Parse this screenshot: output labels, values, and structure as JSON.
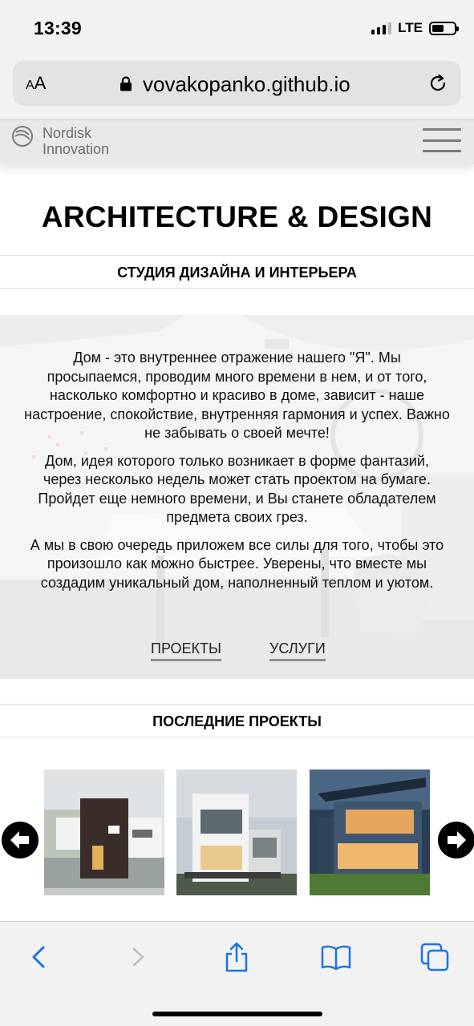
{
  "status_bar": {
    "time": "13:39",
    "network": "LTE",
    "signal_bars_active": 3,
    "signal_bars_total": 4,
    "battery_level_percent": 55
  },
  "browser": {
    "text_size_label_small": "A",
    "text_size_label_large": "A",
    "url": "vovakopanko.github.io",
    "lock_icon": "lock-icon",
    "reload_icon": "reload-icon"
  },
  "site_header": {
    "logo_line1": "Nordisk",
    "logo_line2": "Innovation",
    "menu_icon": "hamburger-menu-icon"
  },
  "page": {
    "title": "ARCHITECTURE & DESIGN",
    "subtitle": "СТУДИЯ ДИЗАЙНА И ИНТЕРЬЕРА",
    "hero_paragraphs": [
      "Дом - это внутреннее отражение нашего \"Я\". Мы просыпаемся, проводим много времени в нем, и от того, насколько комфортно и красиво в доме, зависит - наше настроение, спокойствие, внутренняя гармония и успех. Важно не забывать о своей мечте!",
      "Дом, идея которого только возникает в форме фантазий, через несколько недель может стать проектом на бумаге. Пройдет еще немного времени, и Вы станете обладателем предмета своих грез.",
      "А мы в свою очередь приложем все силы для того, чтобы это произошло как можно быстрее. Уверены, что вместе мы создадим уникальный дом, наполненный теплом и уютом."
    ],
    "hero_links": {
      "projects": "ПРОЕКТЫ",
      "services": "УСЛУГИ"
    },
    "recent_projects_heading": "ПОСЛЕДНИЕ ПРОЕКТЫ",
    "carousel": {
      "prev_icon": "arrow-left-icon",
      "next_icon": "arrow-right-icon",
      "items": [
        "project-photo-1",
        "project-photo-2",
        "project-photo-3"
      ]
    }
  },
  "toolbar": {
    "back_icon": "chevron-left-icon",
    "forward_icon": "chevron-right-icon",
    "share_icon": "share-icon",
    "bookmarks_icon": "book-icon",
    "tabs_icon": "tabs-icon",
    "accent_color": "#1a73e8",
    "disabled_color": "#b8b8bb"
  }
}
